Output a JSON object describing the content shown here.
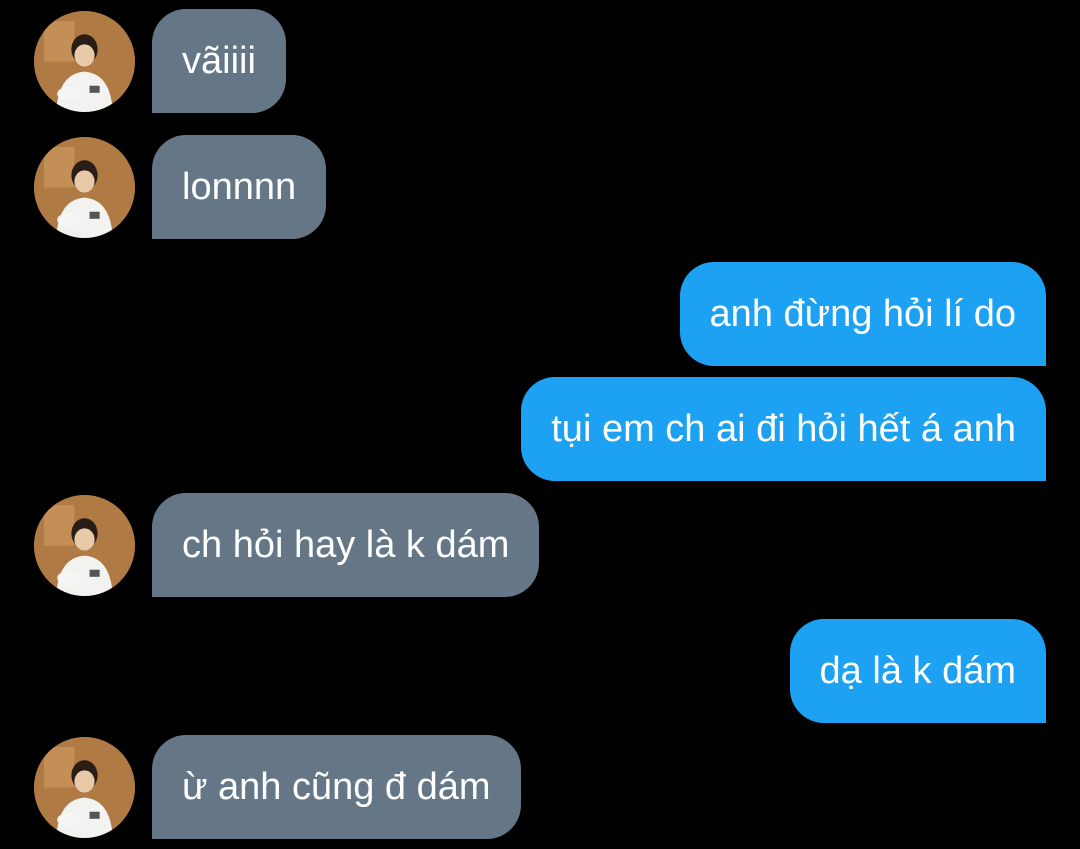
{
  "colors": {
    "background": "#000000",
    "incoming_bubble": "#657786",
    "outgoing_bubble": "#1da1f2",
    "text": "#ffffff"
  },
  "messages": [
    {
      "direction": "incoming",
      "text": "vãiiii"
    },
    {
      "direction": "incoming",
      "text": "lonnnn"
    },
    {
      "direction": "outgoing",
      "text": "anh đừng hỏi lí do"
    },
    {
      "direction": "outgoing",
      "text": "tụi em ch ai đi hỏi hết á anh"
    },
    {
      "direction": "incoming",
      "text": "ch hỏi hay là k dám"
    },
    {
      "direction": "outgoing",
      "text": "dạ là k dám"
    },
    {
      "direction": "incoming",
      "text": "ừ anh cũng đ dám"
    }
  ]
}
